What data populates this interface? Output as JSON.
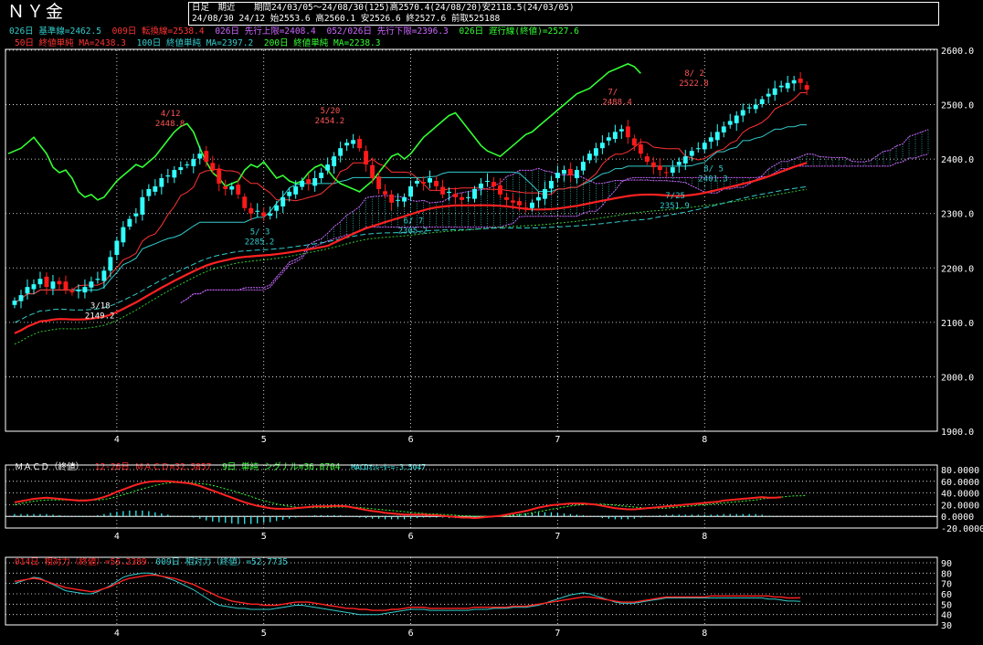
{
  "header": {
    "title": "ＮＹ金",
    "mode": "日足　期近",
    "period": "期間24/03/05～24/08/30(125)高2570.4(24/08/20)安2118.5(24/03/05)",
    "lastbar": "24/08/30 24/12 始2553.6 高2560.1 安2526.6 終2527.6 前取525188"
  },
  "legend": {
    "l1": [
      {
        "text": "026日 基準線=2462.5",
        "color": "#33cccc"
      },
      {
        "text": "009日 転換線=2538.4",
        "color": "#ff3333"
      },
      {
        "text": "026日 先行上限=2408.4",
        "color": "#cc66ff"
      },
      {
        "text": "052/026日 先行下限=2396.3",
        "color": "#cc66ff"
      },
      {
        "text": "026日 遅行線(終値)=2527.6",
        "color": "#33ff33"
      }
    ],
    "l2": [
      {
        "text": "50日 終値単純 MA=2438.3",
        "color": "#ff3333"
      },
      {
        "text": "100日 終値単純 MA=2397.2",
        "color": "#33cccc"
      },
      {
        "text": "200日 終値単純 MA=2238.3",
        "color": "#33ff33"
      }
    ]
  },
  "chart_data": [
    {
      "type": "candlestick",
      "panel": "price",
      "ylim": [
        1900,
        2600
      ],
      "yticks": [
        "2600.0",
        "2500.0",
        "2400.0",
        "2300.0",
        "2200.0",
        "2100.0",
        "2000.0",
        "1900.0"
      ],
      "xticks": [
        "4",
        "5",
        "6",
        "7",
        "8"
      ],
      "xtick_index": [
        16,
        39,
        62,
        85,
        108
      ],
      "n_bars": 125,
      "close": [
        2140,
        2150,
        2165,
        2170,
        2180,
        2165,
        2175,
        2170,
        2160,
        2155,
        2160,
        2165,
        2175,
        2180,
        2195,
        2220,
        2250,
        2275,
        2290,
        2300,
        2330,
        2345,
        2350,
        2365,
        2370,
        2380,
        2385,
        2390,
        2400,
        2410,
        2395,
        2380,
        2355,
        2345,
        2350,
        2335,
        2310,
        2300,
        2305,
        2295,
        2300,
        2315,
        2330,
        2340,
        2350,
        2360,
        2355,
        2365,
        2375,
        2390,
        2405,
        2420,
        2430,
        2435,
        2420,
        2390,
        2365,
        2345,
        2335,
        2320,
        2325,
        2330,
        2350,
        2360,
        2355,
        2365,
        2350,
        2335,
        2340,
        2330,
        2325,
        2330,
        2345,
        2355,
        2360,
        2350,
        2335,
        2325,
        2320,
        2315,
        2310,
        2320,
        2330,
        2345,
        2360,
        2375,
        2380,
        2370,
        2380,
        2395,
        2410,
        2420,
        2430,
        2440,
        2450,
        2455,
        2440,
        2425,
        2410,
        2395,
        2385,
        2380,
        2375,
        2385,
        2395,
        2405,
        2415,
        2420,
        2430,
        2440,
        2450,
        2460,
        2470,
        2480,
        2490,
        2495,
        2500,
        2510,
        2520,
        2530,
        2535,
        2540,
        2545,
        2540,
        2527.6
      ],
      "annotations": [
        {
          "label": "3/18",
          "value": "2149.2",
          "i": 13,
          "color": "#ffffff"
        },
        {
          "label": "4/12",
          "value": "2448.8",
          "i": 24,
          "color": "#ff5555"
        },
        {
          "label": "5/ 3",
          "value": "2285.2",
          "i": 38,
          "color": "#33cccc"
        },
        {
          "label": "5/20",
          "value": "2454.2",
          "i": 49,
          "color": "#ff5555"
        },
        {
          "label": "6/ 7",
          "value": "2305.2",
          "i": 62,
          "color": "#33cccc"
        },
        {
          "label": "7/",
          "value": "2488.4",
          "i": 94,
          "color": "#ff5555"
        },
        {
          "label": "7/25",
          "value": "2351.9",
          "i": 103,
          "color": "#33cccc"
        },
        {
          "label": "8/ 5",
          "value": "2401.3",
          "i": 109,
          "color": "#33cccc"
        },
        {
          "label": "8/ 2",
          "value": "2522.8",
          "i": 106,
          "color": "#ff5555"
        }
      ]
    },
    {
      "type": "line",
      "panel": "macd",
      "title": "ＭＡＣＤ（終値）",
      "series": [
        {
          "name": "12-26日 ＭＡＣＤ=32.5857",
          "color": "#ff2222"
        },
        {
          "name": "9日 単純 シグナル=36.0704",
          "color": "#33ff33"
        },
        {
          "name": "MACDｵｼﾚｰﾀｰ=-3.5047",
          "color": "#33ffff"
        }
      ],
      "ylim": [
        -20,
        80
      ],
      "yticks": [
        "80.0000",
        "60.0000",
        "40.0000",
        "20.0000",
        "0.0000",
        "-20.0000"
      ],
      "macd": [
        24,
        26,
        28,
        30,
        31,
        32,
        31,
        30,
        29,
        28,
        27,
        27,
        28,
        30,
        33,
        37,
        42,
        46,
        50,
        54,
        57,
        59,
        60,
        60,
        60,
        59,
        58,
        57,
        55,
        52,
        48,
        44,
        40,
        36,
        32,
        28,
        24,
        21,
        18,
        16,
        14,
        13,
        13,
        13,
        14,
        15,
        16,
        17,
        17,
        17,
        18,
        18,
        17,
        15,
        13,
        11,
        9,
        8,
        6,
        5,
        4,
        3,
        3,
        3,
        3,
        2,
        2,
        1,
        0,
        -1,
        -2,
        -2,
        -3,
        -2,
        -1,
        0,
        1,
        3,
        5,
        7,
        9,
        12,
        15,
        17,
        19,
        20,
        21,
        22,
        22,
        22,
        21,
        20,
        18,
        16,
        14,
        13,
        12,
        12,
        13,
        14,
        15,
        16,
        17,
        18,
        19,
        20,
        21,
        22,
        23,
        24,
        25,
        27,
        28,
        29,
        30,
        31,
        32,
        33,
        32,
        32,
        32.5857
      ],
      "signal": [
        20,
        22,
        24,
        26,
        27,
        28,
        28,
        28,
        28,
        28,
        28,
        28,
        28,
        28,
        29,
        31,
        34,
        37,
        40,
        44,
        47,
        50,
        53,
        55,
        57,
        58,
        58,
        58,
        57,
        56,
        55,
        53,
        50,
        47,
        44,
        41,
        37,
        34,
        30,
        27,
        24,
        21,
        19,
        17,
        16,
        15,
        15,
        15,
        15,
        15,
        16,
        16,
        16,
        16,
        15,
        14,
        13,
        12,
        11,
        10,
        9,
        8,
        7,
        6,
        5,
        4,
        4,
        3,
        3,
        2,
        1,
        1,
        0,
        0,
        0,
        0,
        0,
        1,
        2,
        3,
        4,
        6,
        8,
        10,
        12,
        14,
        16,
        18,
        19,
        20,
        21,
        21,
        21,
        20,
        19,
        18,
        17,
        16,
        15,
        14,
        14,
        14,
        14,
        15,
        16,
        17,
        18,
        19,
        20,
        21,
        22,
        23,
        24,
        25,
        26,
        27,
        28,
        30,
        31,
        32,
        33,
        34,
        35,
        35,
        36.0704
      ]
    },
    {
      "type": "line",
      "panel": "rsi",
      "series": [
        {
          "name": "014日 相対力（終値）=56.2389",
          "color": "#ff2222"
        },
        {
          "name": "009日 相対力（終値）=52.7735",
          "color": "#33cccc"
        }
      ],
      "ylim": [
        30,
        90
      ],
      "yticks": [
        "90",
        "80",
        "70",
        "60",
        "50",
        "40",
        "30"
      ],
      "rsi14": [
        72,
        73,
        74,
        75,
        74,
        72,
        70,
        68,
        66,
        65,
        64,
        63,
        62,
        63,
        65,
        67,
        70,
        73,
        75,
        76,
        77,
        78,
        78,
        77,
        76,
        75,
        73,
        71,
        69,
        66,
        63,
        60,
        57,
        55,
        53,
        52,
        51,
        50,
        50,
        49,
        49,
        49,
        50,
        51,
        52,
        52,
        52,
        51,
        50,
        49,
        48,
        47,
        46,
        46,
        45,
        45,
        44,
        44,
        44,
        45,
        45,
        46,
        47,
        47,
        47,
        46,
        46,
        46,
        46,
        46,
        46,
        46,
        47,
        47,
        47,
        47,
        47,
        47,
        48,
        48,
        48,
        49,
        50,
        51,
        52,
        53,
        54,
        55,
        56,
        57,
        57,
        56,
        55,
        54,
        53,
        52,
        52,
        52,
        53,
        54,
        55,
        56,
        57,
        57,
        57,
        57,
        57,
        57,
        57,
        58,
        58,
        58,
        58,
        58,
        58,
        58,
        58,
        58,
        58,
        57,
        57,
        56,
        56,
        56.2389
      ],
      "rsi9": [
        70,
        72,
        74,
        76,
        75,
        72,
        69,
        66,
        63,
        62,
        61,
        60,
        60,
        62,
        65,
        68,
        72,
        76,
        78,
        79,
        80,
        80,
        79,
        77,
        75,
        73,
        70,
        67,
        64,
        60,
        56,
        52,
        49,
        48,
        47,
        46,
        46,
        45,
        45,
        45,
        45,
        46,
        47,
        48,
        49,
        49,
        48,
        47,
        46,
        45,
        44,
        43,
        42,
        41,
        40,
        40,
        40,
        40,
        41,
        42,
        43,
        44,
        45,
        45,
        45,
        44,
        44,
        44,
        44,
        44,
        44,
        44,
        45,
        45,
        45,
        46,
        46,
        46,
        47,
        47,
        47,
        48,
        49,
        51,
        53,
        55,
        57,
        59,
        60,
        61,
        60,
        58,
        56,
        54,
        52,
        51,
        51,
        51,
        52,
        53,
        54,
        55,
        56,
        56,
        56,
        56,
        56,
        56,
        56,
        56,
        56,
        56,
        56,
        56,
        56,
        56,
        56,
        56,
        55,
        55,
        54,
        53,
        53,
        52.7735
      ]
    }
  ]
}
